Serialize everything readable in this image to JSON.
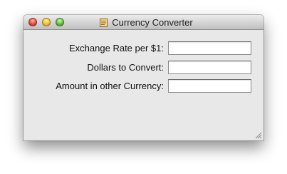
{
  "window": {
    "title": "Currency Converter",
    "title_icon": "document-icon"
  },
  "form": {
    "fields": [
      {
        "label": "Exchange Rate per $1:",
        "value": "",
        "placeholder": ""
      },
      {
        "label": "Dollars to Convert:",
        "value": "",
        "placeholder": ""
      },
      {
        "label": "Amount in other Currency:",
        "value": "",
        "placeholder": ""
      }
    ]
  },
  "colors": {
    "close": "#e0443a",
    "minimize": "#f4b927",
    "zoom": "#58b935",
    "window_background": "#e8e8e8"
  }
}
